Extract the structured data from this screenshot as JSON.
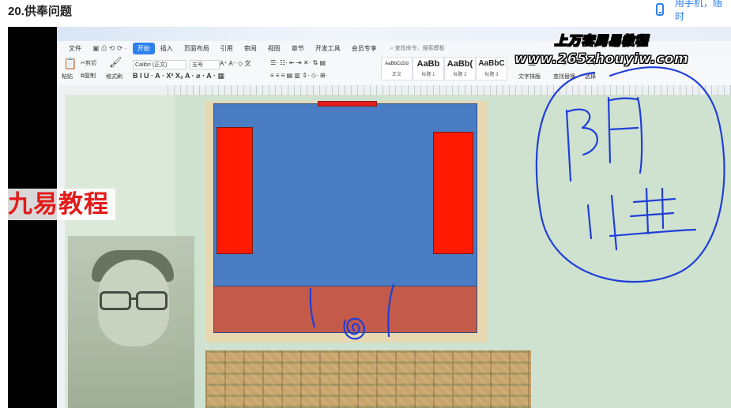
{
  "page": {
    "title": "20.供奉问题",
    "mobile_link": "用手机，随时"
  },
  "wps": {
    "menu": [
      "文件",
      "开始",
      "插入",
      "页面布局",
      "引用",
      "审阅",
      "视图",
      "章节",
      "开发工具",
      "会员专享"
    ],
    "active_menu": "开始",
    "search_placeholder": "查找命令、搜索模板",
    "ribbon": {
      "paste": "粘贴",
      "cut": "剪切",
      "copy": "复制",
      "format_painter": "格式刷",
      "font_name": "Calibri (正文)",
      "font_size": "五号",
      "text_layout": "文字排版",
      "find_replace": "查找替换",
      "select": "选择",
      "styles": [
        {
          "sample": "AaBbCcDd",
          "name": "正文"
        },
        {
          "sample": "AaBb",
          "name": "标题 1"
        },
        {
          "sample": "AaBb(",
          "name": "标题 2"
        },
        {
          "sample": "AaBbC",
          "name": "标题 3"
        }
      ]
    }
  },
  "overlay": {
    "side_watermark": "九易教程",
    "watermark_title": "上万套周易教程",
    "watermark_url": "www.265zhouyiw.com"
  },
  "colors": {
    "blue": "#4a7cc4",
    "red": "#ff1a00",
    "bottom": "#c35a4a",
    "ink": "#1f3fd8",
    "accent": "#2f80ed"
  }
}
